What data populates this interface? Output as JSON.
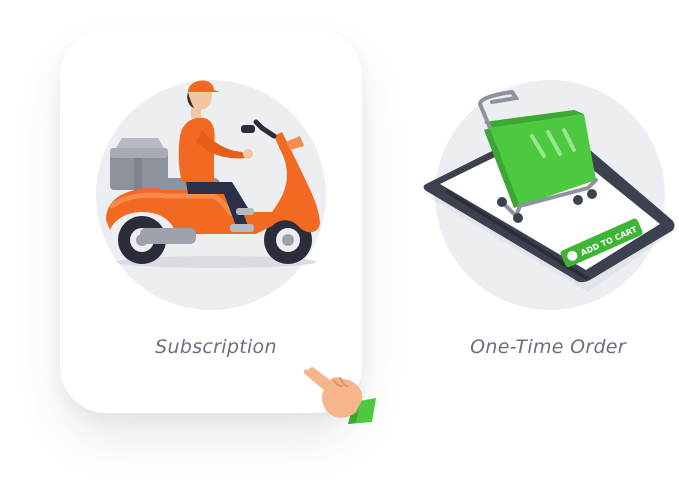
{
  "options": [
    {
      "label": "Subscription",
      "selected": true,
      "icon": "delivery-scooter-icon"
    },
    {
      "label": "One-Time Order",
      "selected": false,
      "icon": "shopping-cart-phone-icon",
      "phone_button_label": "ADD TO CART"
    }
  ],
  "cursor_icon": "pointing-hand-icon",
  "colors": {
    "card_background": "#ffffff",
    "circle_background": "#eceef1",
    "label_text": "#6b6f7b",
    "scooter_orange": "#f26a22",
    "cart_green": "#4cc93f",
    "phone_dark": "#3c4150"
  }
}
